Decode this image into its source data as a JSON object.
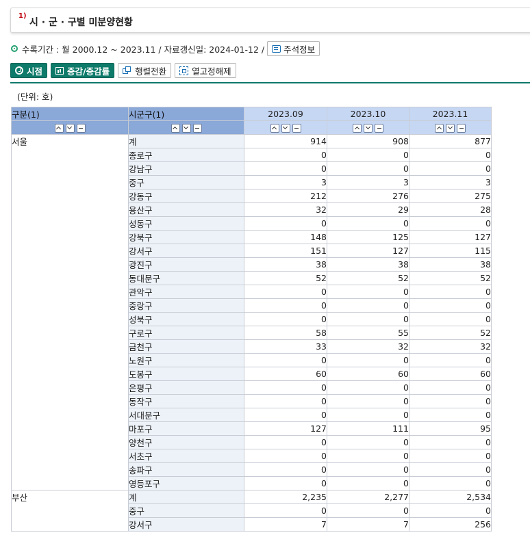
{
  "page": {
    "title_sup": "1)",
    "title": "시 · 군 · 구별 미분양현황",
    "info_text": "수록기간 : 월 2000.12 ~ 2023.11 / 자료갱신일: 2024-01-12 /",
    "note_button": "주석정보",
    "unit": "(단위: 호)"
  },
  "toolbar": {
    "time_label": "시점",
    "change_label": "증감/증감률",
    "pivot_label": "행렬전환",
    "unfreeze_label": "열고정해제"
  },
  "table": {
    "dim_headers": [
      "구분(1)",
      "시군구(1)"
    ],
    "col_headers": [
      "2023.09",
      "2023.10",
      "2023.11"
    ],
    "groups": [
      {
        "region": "서울",
        "rows": [
          {
            "name": "계",
            "values": [
              "914",
              "908",
              "877"
            ]
          },
          {
            "name": "종로구",
            "values": [
              "0",
              "0",
              "0"
            ]
          },
          {
            "name": "강남구",
            "values": [
              "0",
              "0",
              "0"
            ]
          },
          {
            "name": "중구",
            "values": [
              "3",
              "3",
              "3"
            ]
          },
          {
            "name": "강동구",
            "values": [
              "212",
              "276",
              "275"
            ]
          },
          {
            "name": "용산구",
            "values": [
              "32",
              "29",
              "28"
            ]
          },
          {
            "name": "성동구",
            "values": [
              "0",
              "0",
              "0"
            ]
          },
          {
            "name": "강북구",
            "values": [
              "148",
              "125",
              "127"
            ]
          },
          {
            "name": "강서구",
            "values": [
              "151",
              "127",
              "115"
            ]
          },
          {
            "name": "광진구",
            "values": [
              "38",
              "38",
              "38"
            ]
          },
          {
            "name": "동대문구",
            "values": [
              "52",
              "52",
              "52"
            ]
          },
          {
            "name": "관악구",
            "values": [
              "0",
              "0",
              "0"
            ]
          },
          {
            "name": "중랑구",
            "values": [
              "0",
              "0",
              "0"
            ]
          },
          {
            "name": "성북구",
            "values": [
              "0",
              "0",
              "0"
            ]
          },
          {
            "name": "구로구",
            "values": [
              "58",
              "55",
              "52"
            ]
          },
          {
            "name": "금천구",
            "values": [
              "33",
              "32",
              "32"
            ]
          },
          {
            "name": "노원구",
            "values": [
              "0",
              "0",
              "0"
            ]
          },
          {
            "name": "도봉구",
            "values": [
              "60",
              "60",
              "60"
            ]
          },
          {
            "name": "은평구",
            "values": [
              "0",
              "0",
              "0"
            ]
          },
          {
            "name": "동작구",
            "values": [
              "0",
              "0",
              "0"
            ]
          },
          {
            "name": "서대문구",
            "values": [
              "0",
              "0",
              "0"
            ]
          },
          {
            "name": "마포구",
            "values": [
              "127",
              "111",
              "95"
            ]
          },
          {
            "name": "양천구",
            "values": [
              "0",
              "0",
              "0"
            ]
          },
          {
            "name": "서초구",
            "values": [
              "0",
              "0",
              "0"
            ]
          },
          {
            "name": "송파구",
            "values": [
              "0",
              "0",
              "0"
            ]
          },
          {
            "name": "영등포구",
            "values": [
              "0",
              "0",
              "0"
            ]
          }
        ]
      },
      {
        "region": "부산",
        "rows": [
          {
            "name": "계",
            "values": [
              "2,235",
              "2,277",
              "2,534"
            ]
          },
          {
            "name": "중구",
            "values": [
              "0",
              "0",
              "0"
            ]
          },
          {
            "name": "강서구",
            "values": [
              "7",
              "7",
              "256"
            ]
          }
        ]
      }
    ]
  },
  "colors": {
    "accent_green": "#0e7a6a",
    "dim_header_bg": "#8aa8d8",
    "col_header_bg": "#c6d7f3",
    "dim_cell_bg": "#edf2f8",
    "title_marker": "#c0000c"
  },
  "icons": {
    "time": "clock-icon",
    "change": "chart-icon",
    "pivot": "swap-icon",
    "unfreeze": "unfreeze-icon",
    "note": "comment-icon",
    "sort_up": "chevron-up-icon",
    "sort_down": "chevron-down-icon",
    "collapse": "minus-icon"
  }
}
